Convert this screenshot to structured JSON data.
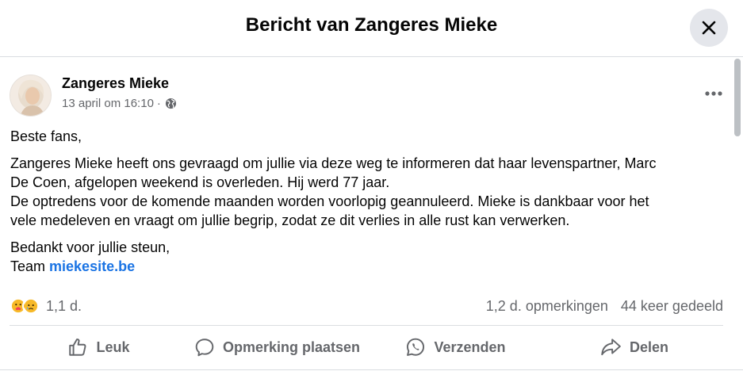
{
  "dialog": {
    "title": "Bericht van Zangeres Mieke",
    "close_icon": "close-icon"
  },
  "post": {
    "author": "Zangeres Mieke",
    "timestamp": "13 april om 16:10",
    "separator": "·",
    "audience_icon": "globe-icon",
    "more_icon": "more-horizontal-icon",
    "body": {
      "greeting": "Beste fans,",
      "paragraph1_line1": "Zangeres Mieke heeft ons gevraagd om jullie via deze weg te informeren dat haar levenspartner, Marc",
      "paragraph1_line2": "De Coen, afgelopen weekend is overleden. Hij werd 77 jaar.",
      "paragraph1_line3": "De optredens voor de komende maanden worden voorlopig geannuleerd. Mieke is dankbaar voor het",
      "paragraph1_line4": "vele medeleven en vraagt om jullie begrip, zodat ze dit verlies in alle rust kan verwerken.",
      "closing_line1": "Bedankt voor jullie steun,",
      "closing_prefix": "Team ",
      "closing_link": "miekesite.be"
    }
  },
  "stats": {
    "reactions": [
      "care",
      "sad"
    ],
    "reaction_count": "1,1 d.",
    "comments": "1,2 d. opmerkingen",
    "shares": "44 keer gedeeld"
  },
  "actions": {
    "like": "Leuk",
    "comment": "Opmerking plaatsen",
    "send": "Verzenden",
    "share": "Delen"
  },
  "colors": {
    "link": "#1b74e4",
    "secondary_text": "#65676b",
    "divider": "#dadde1",
    "close_bg": "#e4e6eb"
  }
}
